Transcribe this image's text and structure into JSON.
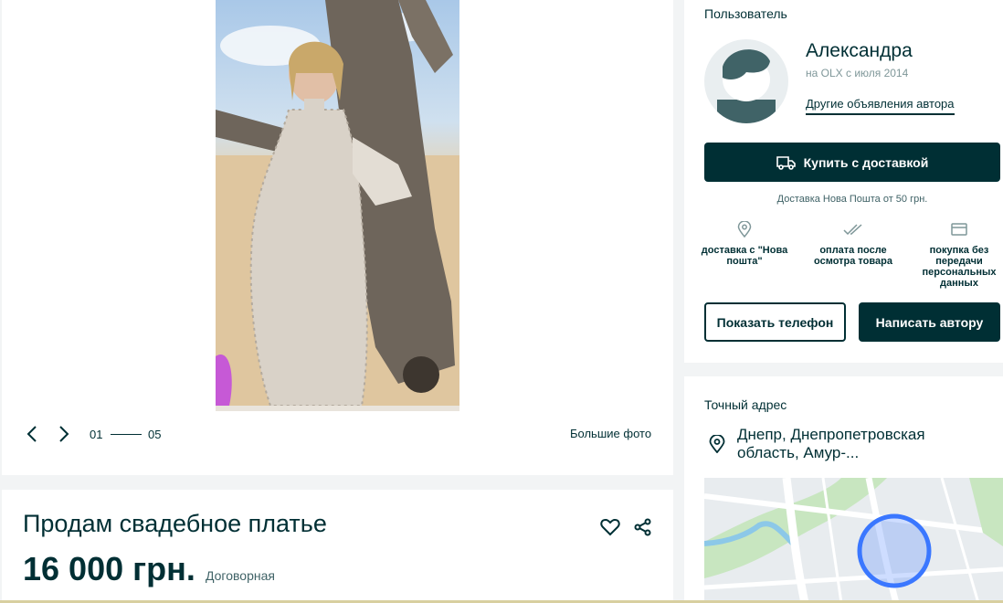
{
  "gallery": {
    "counter_current": "01",
    "counter_total": "05",
    "big_photo_label": "Большие фото"
  },
  "ad": {
    "title": "Продам свадебное платье",
    "price": "16 000 грн.",
    "negotiable": "Договорная"
  },
  "user": {
    "section_label": "Пользователь",
    "name": "Александра",
    "since": "на OLX с июля 2014",
    "other_ads": "Другие объявления автора"
  },
  "delivery": {
    "buy_label": "Купить с доставкой",
    "note": "Доставка Нова Пошта от 50 грн.",
    "features": [
      {
        "icon": "location-pin-icon",
        "text": "доставка с \"Нова пошта\""
      },
      {
        "icon": "double-check-icon",
        "text": "оплата после осмотра товара"
      },
      {
        "icon": "card-icon",
        "text": "покупка без передачи персональных данных"
      }
    ]
  },
  "actions": {
    "show_phone": "Показать телефон",
    "write_author": "Написать автору"
  },
  "address": {
    "section_label": "Точный адрес",
    "text": "Днепр, Днепропетровская область, Амур-..."
  },
  "colors": {
    "primary": "#002f34",
    "background": "#f2f4f5",
    "map_circle": "#3a77ff"
  }
}
